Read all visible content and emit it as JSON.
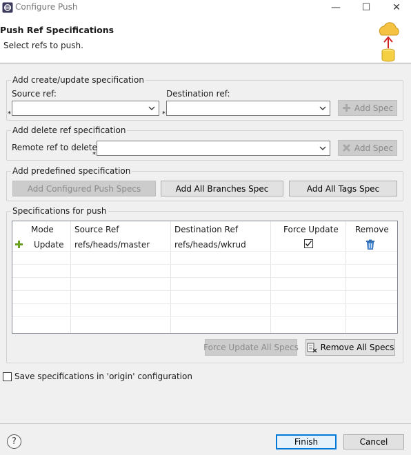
{
  "window": {
    "title": "Configure Push",
    "minimize_glyph": "—",
    "maximize_glyph": "☐",
    "close_glyph": "✕"
  },
  "header": {
    "title": "Push Ref Specifications",
    "subtitle": "Select refs to push.",
    "banner_icon": "cloud-push-icon"
  },
  "create_group": {
    "legend": "Add create/update specification",
    "source_label": "Source ref:",
    "source_value": "",
    "dest_label": "Destination ref:",
    "dest_value": "",
    "required_marker": "*",
    "add_spec_label": "Add Spec"
  },
  "delete_group": {
    "legend": "Add delete ref specification",
    "remote_label": "Remote ref to delete:",
    "remote_value": "",
    "required_marker": "*",
    "add_spec_label": "Add Spec"
  },
  "predefined_group": {
    "legend": "Add predefined specification",
    "configured_label": "Add Configured Push Specs",
    "all_branches_label": "Add All Branches Spec",
    "all_tags_label": "Add All Tags Spec"
  },
  "specs_group": {
    "legend": "Specifications for push",
    "columns": [
      "Mode",
      "Source Ref",
      "Destination Ref",
      "Force Update",
      "Remove"
    ],
    "rows": [
      {
        "mode": "Update",
        "source": "refs/heads/master",
        "destination": "refs/heads/wkrud",
        "force_update": true
      }
    ],
    "force_all_label": "Force Update All Specs",
    "remove_all_label": "Remove All Specs"
  },
  "save_checkbox": {
    "label": "Save specifications in 'origin' configuration",
    "checked": false
  },
  "footer": {
    "help_glyph": "?",
    "finish_label": "Finish",
    "cancel_label": "Cancel"
  },
  "colors": {
    "accent": "#0078d7",
    "add_icon": "#6aa121",
    "delete_icon": "#2f6db5"
  }
}
